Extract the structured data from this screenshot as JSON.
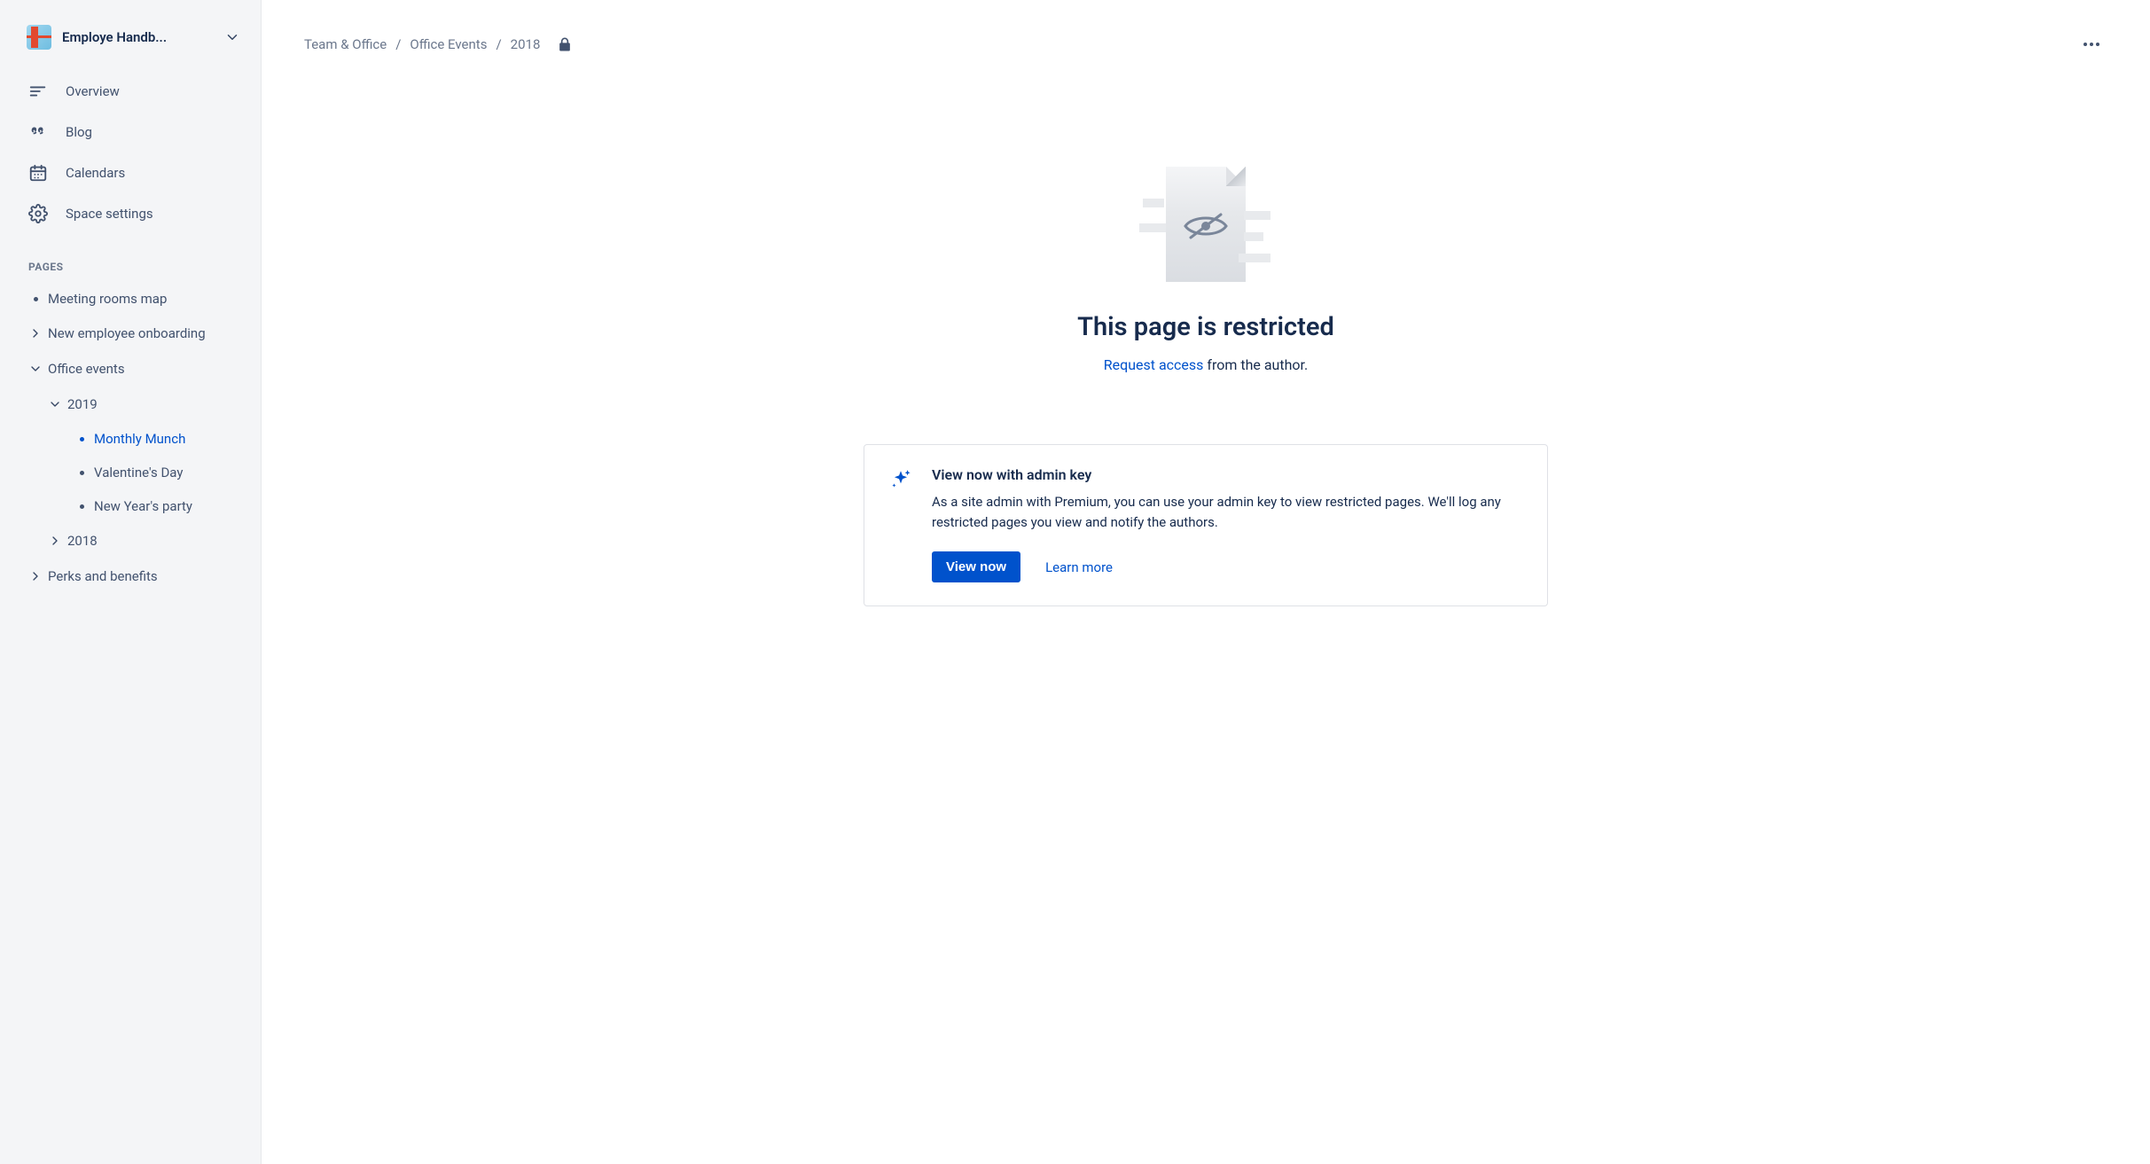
{
  "space": {
    "title": "Employe Handb..."
  },
  "nav": {
    "overview": "Overview",
    "blog": "Blog",
    "calendars": "Calendars",
    "space_settings": "Space settings"
  },
  "pages_heading": "PAGES",
  "tree": {
    "meeting_rooms": "Meeting rooms map",
    "new_employee": "New employee onboarding",
    "office_events": "Office events",
    "y2019": "2019",
    "monthly_munch": "Monthly Munch",
    "valentines": "Valentine's Day",
    "new_years": "New Year's party",
    "y2018": "2018",
    "perks": "Perks and benefits"
  },
  "breadcrumbs": {
    "a": "Team & Office",
    "b": "Office Events",
    "c": "2018"
  },
  "restricted": {
    "title": "This page is restricted",
    "request_link": "Request access",
    "request_suffix": " from the author."
  },
  "admin": {
    "title": "View now with admin key",
    "desc": "As a site admin with Premium, you can use your admin key to view restricted pages. We'll log any restricted pages you view and notify the authors.",
    "view_now": "View now",
    "learn_more": "Learn more"
  }
}
